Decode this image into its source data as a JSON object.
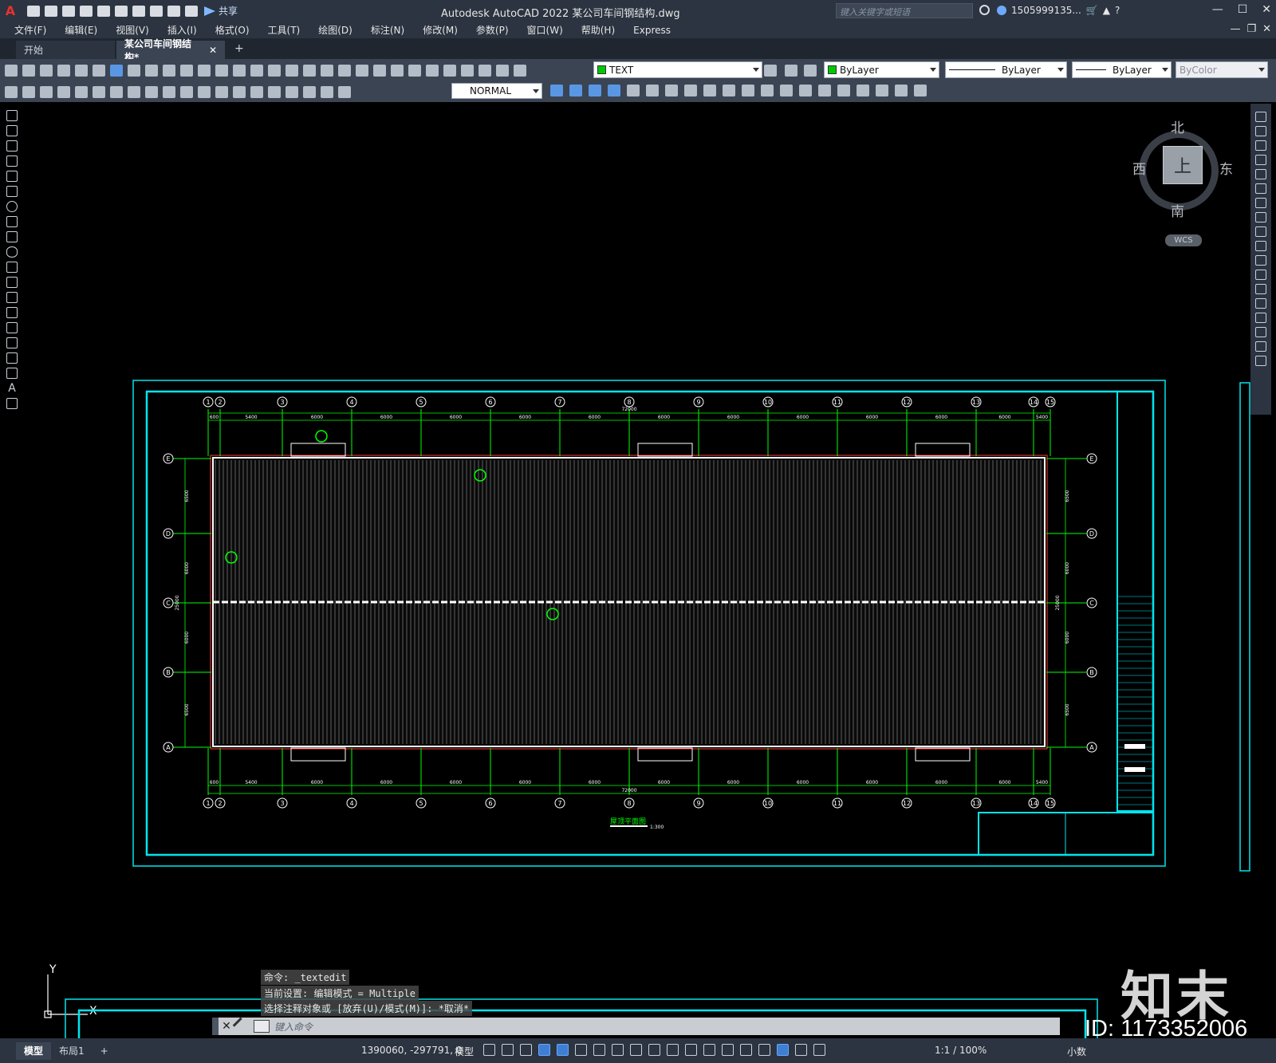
{
  "app": {
    "logo": "A",
    "title": "Autodesk AutoCAD 2022    某公司车间钢结构.dwg",
    "share_label": "共享",
    "search_placeholder": "键入关键字或短语",
    "user": "1505999135...",
    "window_controls": [
      "—",
      "☐",
      "✕"
    ],
    "doc_controls": [
      "—",
      "❐",
      "✕"
    ]
  },
  "menu": [
    "文件(F)",
    "编辑(E)",
    "视图(V)",
    "插入(I)",
    "格式(O)",
    "工具(T)",
    "绘图(D)",
    "标注(N)",
    "修改(M)",
    "参数(P)",
    "窗口(W)",
    "帮助(H)",
    "Express"
  ],
  "tabs": {
    "start": "开始",
    "active": "某公司车间钢结构*",
    "close": "✕",
    "add": "+"
  },
  "toolbar": {
    "layer": "TEXT",
    "layer_color": "#00c800",
    "color": "ByLayer",
    "color_swatch": "#00c800",
    "linetype": "ByLayer",
    "lineweight": "ByLayer",
    "plotstyle": "ByColor",
    "dimstyle": "NORMAL"
  },
  "viewcube": {
    "north": "北",
    "south": "南",
    "east": "东",
    "west": "西",
    "face": "上",
    "wcs": "WCS"
  },
  "drawing": {
    "colors": {
      "frame": "#00e5ee",
      "grid": "#00ff00",
      "roof": "#ffffff",
      "edge": "#ff3b3b"
    },
    "grid_top_labels": [
      "1",
      "2",
      "3",
      "4",
      "5",
      "6",
      "7",
      "8",
      "9",
      "10",
      "11",
      "12",
      "13",
      "14",
      "15"
    ],
    "grid_side_labels": [
      "E",
      "D",
      "C",
      "B",
      "A"
    ],
    "overall_length": "72000",
    "dims_top": [
      "600",
      "5400",
      "6000",
      "6000",
      "6000",
      "6000",
      "6000",
      "6000",
      "6000",
      "6000",
      "6000",
      "6000",
      "6000",
      "5400",
      "600"
    ],
    "side_dims": [
      "6500",
      "6000",
      "6000",
      "6500"
    ],
    "side_total": "25000",
    "caption": "屋顶平面图",
    "caption_scale": "1:300"
  },
  "command": {
    "history": [
      "命令: _textedit",
      "当前设置: 编辑模式 = Multiple",
      "选择注释对象或 [放弃(U)/模式(M)]: *取消*"
    ],
    "placeholder": "键入命令"
  },
  "status": {
    "tabs": [
      "模型",
      "布局1",
      "+"
    ],
    "coords": "1390060, -297791, 0",
    "mode": "模型",
    "scale": "1:1 / 100%",
    "units": "小数"
  },
  "watermark": {
    "logo": "知末",
    "id": "ID: 1173352006"
  }
}
